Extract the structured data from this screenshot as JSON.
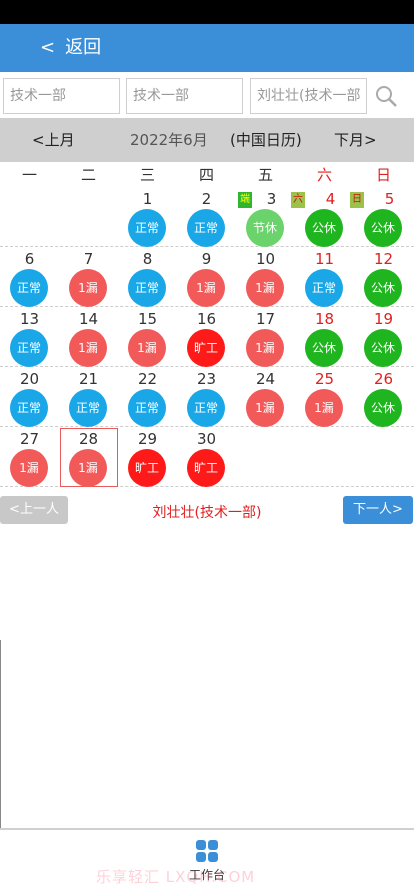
{
  "header": {
    "back_chevron": "<",
    "back_label": "返回"
  },
  "filters": [
    {
      "placeholder": "技术一部"
    },
    {
      "placeholder": "技术一部"
    },
    {
      "placeholder": "刘壮壮(技术一部"
    }
  ],
  "month_bar": {
    "prev": "<上月",
    "month": "2022年6月",
    "calendar": "(中国日历)",
    "next": "下月>"
  },
  "weekdays": [
    "一",
    "二",
    "三",
    "四",
    "五",
    "六",
    "日"
  ],
  "weeks": [
    [
      null,
      null,
      {
        "day": "1",
        "status": "正常",
        "type": "normal"
      },
      {
        "day": "2",
        "status": "正常",
        "type": "normal"
      },
      {
        "day": "3",
        "status": "节休",
        "type": "holiday",
        "tag": "端",
        "tag_style": "green"
      },
      {
        "day": "4",
        "status": "公休",
        "type": "rest",
        "red": true,
        "tag": "六",
        "tag_style": "olive"
      },
      {
        "day": "5",
        "status": "公休",
        "type": "rest",
        "red": true,
        "tag": "日",
        "tag_style": "olive"
      }
    ],
    [
      {
        "day": "6",
        "status": "正常",
        "type": "normal"
      },
      {
        "day": "7",
        "status": "1漏",
        "type": "leak"
      },
      {
        "day": "8",
        "status": "正常",
        "type": "normal"
      },
      {
        "day": "9",
        "status": "1漏",
        "type": "leak"
      },
      {
        "day": "10",
        "status": "1漏",
        "type": "leak"
      },
      {
        "day": "11",
        "status": "正常",
        "type": "normal",
        "red": true
      },
      {
        "day": "12",
        "status": "公休",
        "type": "rest",
        "red": true
      }
    ],
    [
      {
        "day": "13",
        "status": "正常",
        "type": "normal"
      },
      {
        "day": "14",
        "status": "1漏",
        "type": "leak"
      },
      {
        "day": "15",
        "status": "1漏",
        "type": "leak"
      },
      {
        "day": "16",
        "status": "旷工",
        "type": "absent"
      },
      {
        "day": "17",
        "status": "1漏",
        "type": "leak"
      },
      {
        "day": "18",
        "status": "公休",
        "type": "rest",
        "red": true
      },
      {
        "day": "19",
        "status": "公休",
        "type": "rest",
        "red": true
      }
    ],
    [
      {
        "day": "20",
        "status": "正常",
        "type": "normal"
      },
      {
        "day": "21",
        "status": "正常",
        "type": "normal"
      },
      {
        "day": "22",
        "status": "正常",
        "type": "normal"
      },
      {
        "day": "23",
        "status": "正常",
        "type": "normal"
      },
      {
        "day": "24",
        "status": "1漏",
        "type": "leak"
      },
      {
        "day": "25",
        "status": "1漏",
        "type": "leak",
        "red": true
      },
      {
        "day": "26",
        "status": "公休",
        "type": "rest",
        "red": true
      }
    ],
    [
      {
        "day": "27",
        "status": "1漏",
        "type": "leak"
      },
      {
        "day": "28",
        "status": "1漏",
        "type": "leak",
        "selected": true
      },
      {
        "day": "29",
        "status": "旷工",
        "type": "absent"
      },
      {
        "day": "30",
        "status": "旷工",
        "type": "absent"
      },
      null,
      null,
      null
    ]
  ],
  "nav": {
    "prev_person": "<上一人",
    "person_name": "刘壮壮(技术一部)",
    "next_person": "下一人>"
  },
  "footer": {
    "work_label": "工作台",
    "watermark": "乐享轻汇 LXQH.COM"
  },
  "colors": {
    "primary": "#3a8fd8",
    "normal": "#1aa7e8",
    "leak": "#f25a5a",
    "absent": "#ff1a1a",
    "holiday": "#6bd36b",
    "rest": "#1fb51f"
  }
}
